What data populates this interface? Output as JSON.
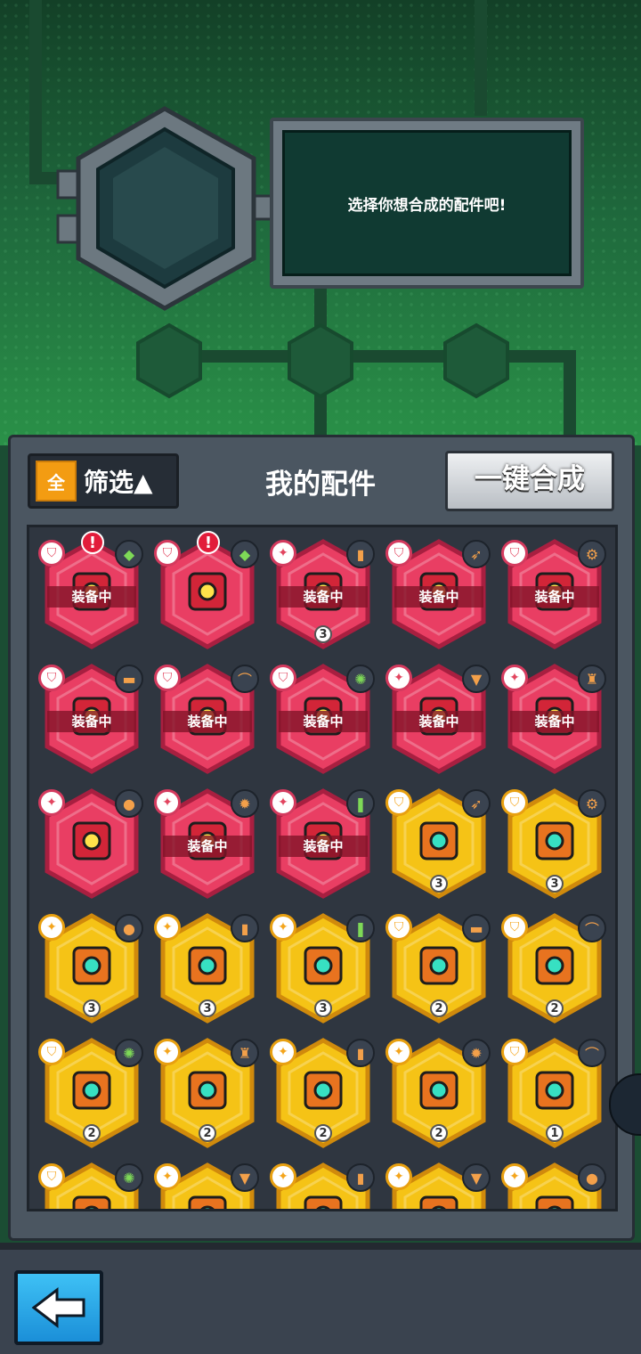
{
  "header": {
    "message": "选择你想合成的配件吧!"
  },
  "panel": {
    "filter_badge": "全",
    "filter_label": "筛选▲",
    "title": "我的配件",
    "merge_all_label": "一键合成"
  },
  "colors": {
    "red_hex": "#e93e63",
    "gold_hex": "#f5c316",
    "board": "#4b5661",
    "accent": "#f39c12"
  },
  "items": [
    {
      "tier": "red",
      "type": "shield",
      "equipped": "装备中",
      "alert": "!",
      "material": "gem-icon",
      "level": null
    },
    {
      "tier": "red",
      "type": "shield",
      "equipped": null,
      "alert": "!",
      "material": "gem-icon",
      "level": null
    },
    {
      "tier": "red",
      "type": "attack",
      "equipped": "装备中",
      "alert": null,
      "material": "battery-icon",
      "level": "3"
    },
    {
      "tier": "red",
      "type": "shield",
      "equipped": "装备中",
      "alert": null,
      "material": "rocket-icon",
      "level": null
    },
    {
      "tier": "red",
      "type": "shield",
      "equipped": "装备中",
      "alert": null,
      "material": "gear-icon",
      "level": null
    },
    {
      "tier": "red",
      "type": "shield",
      "equipped": "装备中",
      "alert": null,
      "material": "brick-icon",
      "level": null
    },
    {
      "tier": "red",
      "type": "shield",
      "equipped": "装备中",
      "alert": null,
      "material": "boomerang-icon",
      "level": null
    },
    {
      "tier": "red",
      "type": "shield",
      "equipped": "装备中",
      "alert": null,
      "material": "virus-icon",
      "level": null
    },
    {
      "tier": "red",
      "type": "attack",
      "equipped": "装备中",
      "alert": null,
      "material": "drill-icon",
      "level": null
    },
    {
      "tier": "red",
      "type": "attack",
      "equipped": "装备中",
      "alert": null,
      "material": "tower-icon",
      "level": null
    },
    {
      "tier": "red",
      "type": "attack",
      "equipped": null,
      "alert": null,
      "material": "ball-icon",
      "level": null
    },
    {
      "tier": "red",
      "type": "attack",
      "equipped": "装备中",
      "alert": null,
      "material": "bomb-icon",
      "level": null
    },
    {
      "tier": "red",
      "type": "attack",
      "equipped": "装备中",
      "alert": null,
      "material": "bottle-icon",
      "level": null
    },
    {
      "tier": "gold",
      "type": "shield",
      "equipped": null,
      "alert": null,
      "material": "rocket-icon",
      "level": "3"
    },
    {
      "tier": "gold",
      "type": "shield",
      "equipped": null,
      "alert": null,
      "material": "gear-icon",
      "level": "3"
    },
    {
      "tier": "gold",
      "type": "attack",
      "equipped": null,
      "alert": null,
      "material": "ball-icon",
      "level": "3"
    },
    {
      "tier": "gold",
      "type": "attack",
      "equipped": null,
      "alert": null,
      "material": "battery-icon",
      "level": "3"
    },
    {
      "tier": "gold",
      "type": "attack",
      "equipped": null,
      "alert": null,
      "material": "bottle-icon",
      "level": "3"
    },
    {
      "tier": "gold",
      "type": "shield",
      "equipped": null,
      "alert": null,
      "material": "brick-icon",
      "level": "2"
    },
    {
      "tier": "gold",
      "type": "shield",
      "equipped": null,
      "alert": null,
      "material": "boomerang-icon",
      "level": "2"
    },
    {
      "tier": "gold",
      "type": "shield",
      "equipped": null,
      "alert": null,
      "material": "virus-icon",
      "level": "2"
    },
    {
      "tier": "gold",
      "type": "attack",
      "equipped": null,
      "alert": null,
      "material": "tower-icon",
      "level": "2"
    },
    {
      "tier": "gold",
      "type": "attack",
      "equipped": null,
      "alert": null,
      "material": "battery-icon",
      "level": "2"
    },
    {
      "tier": "gold",
      "type": "attack",
      "equipped": null,
      "alert": null,
      "material": "bomb-icon",
      "level": "2"
    },
    {
      "tier": "gold",
      "type": "shield",
      "equipped": null,
      "alert": null,
      "material": "boomerang-icon",
      "level": "1"
    },
    {
      "tier": "gold",
      "type": "shield",
      "equipped": null,
      "alert": null,
      "material": "virus-icon",
      "level": null
    },
    {
      "tier": "gold",
      "type": "attack",
      "equipped": null,
      "alert": null,
      "material": "drill-icon",
      "level": null
    },
    {
      "tier": "gold",
      "type": "attack",
      "equipped": null,
      "alert": null,
      "material": "battery-icon",
      "level": null
    },
    {
      "tier": "gold",
      "type": "attack",
      "equipped": null,
      "alert": null,
      "material": "drill-icon",
      "level": null
    },
    {
      "tier": "gold",
      "type": "attack",
      "equipped": null,
      "alert": null,
      "material": "ball-icon",
      "level": null
    }
  ]
}
